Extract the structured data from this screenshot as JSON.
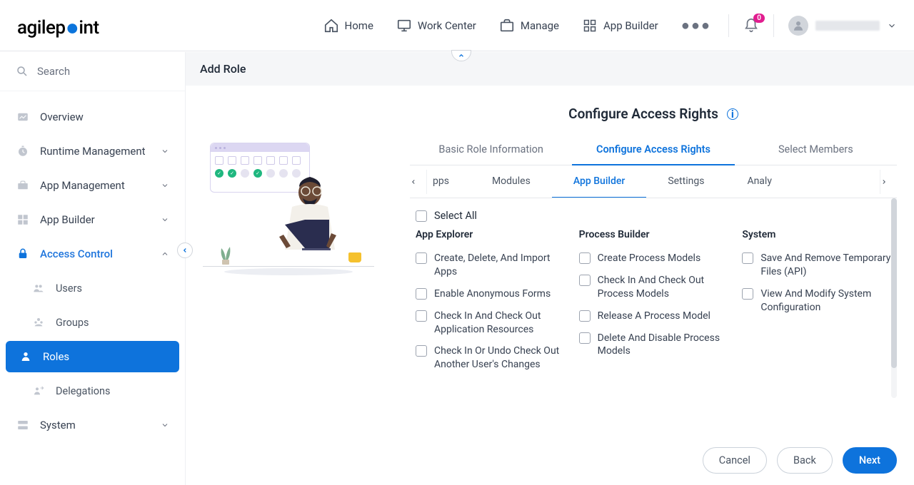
{
  "brand": {
    "name": "agilep",
    "name2": "int"
  },
  "nav": {
    "items": [
      {
        "label": "Home"
      },
      {
        "label": "Work Center"
      },
      {
        "label": "Manage"
      },
      {
        "label": "App Builder"
      }
    ],
    "badge": "0"
  },
  "sidebar": {
    "search_placeholder": "Search",
    "items": [
      {
        "label": "Overview"
      },
      {
        "label": "Runtime Management"
      },
      {
        "label": "App Management"
      },
      {
        "label": "App Builder"
      },
      {
        "label": "Access Control"
      },
      {
        "label": "System"
      }
    ],
    "access_control_children": [
      {
        "label": "Users"
      },
      {
        "label": "Groups"
      },
      {
        "label": "Roles"
      },
      {
        "label": "Delegations"
      }
    ]
  },
  "page": {
    "title": "Add Role",
    "panel_title": "Configure Access Rights",
    "wizard_tabs": [
      {
        "label": "Basic Role Information"
      },
      {
        "label": "Configure Access Rights"
      },
      {
        "label": "Select Members"
      }
    ],
    "sub_tabs": {
      "left_partial": "pps",
      "items": [
        {
          "label": "Modules"
        },
        {
          "label": "App Builder"
        },
        {
          "label": "Settings"
        }
      ],
      "right_partial": "Analy"
    },
    "select_all_label": "Select All",
    "columns": [
      {
        "title": "App Explorer",
        "perms": [
          "Create, Delete, And Import Apps",
          "Enable Anonymous Forms",
          "Check In And Check Out Application Resources",
          "Check In Or Undo Check Out Another User's Changes"
        ]
      },
      {
        "title": "Process Builder",
        "perms": [
          "Create Process Models",
          "Check In And Check Out Process Models",
          "Release A Process Model",
          "Delete And Disable Process Models"
        ]
      },
      {
        "title": "System",
        "perms": [
          "Save And Remove Temporary Files (API)",
          "View And Modify System Configuration"
        ]
      }
    ],
    "buttons": {
      "cancel": "Cancel",
      "back": "Back",
      "next": "Next"
    }
  }
}
